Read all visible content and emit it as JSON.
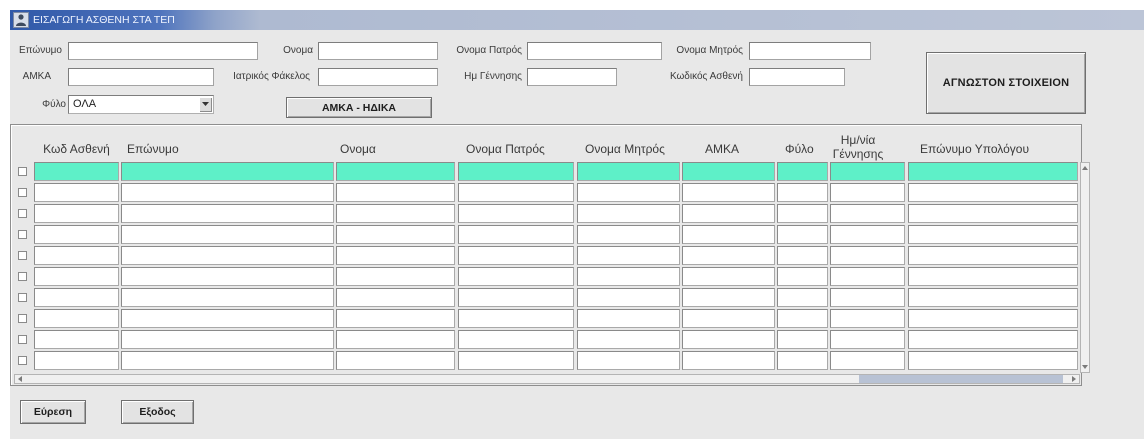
{
  "window": {
    "title": "ΕΙΣΑΓΩΓΗ ΑΣΘΕΝΗ ΣΤΑ ΤΕΠ",
    "icon": "app-icon"
  },
  "search": {
    "surname": {
      "label": "Επώνυμο",
      "value": ""
    },
    "first_name": {
      "label": "Ονομα",
      "value": ""
    },
    "father_name": {
      "label": "Ονομα Πατρός",
      "value": ""
    },
    "mother_name": {
      "label": "Ονομα Μητρός",
      "value": ""
    },
    "amka": {
      "label": "ΑΜΚΑ",
      "value": ""
    },
    "medical_file": {
      "label": "Ιατρικός Φάκελος",
      "value": ""
    },
    "birth_date": {
      "label": "Ημ Γέννησης",
      "value": ""
    },
    "patient_code": {
      "label": "Κωδικός Ασθενή",
      "value": ""
    },
    "gender": {
      "label": "Φύλο",
      "value": "ΟΛΑ",
      "icon": "chevron-down-icon"
    }
  },
  "buttons": {
    "amka_hdika": "ΑΜΚΑ - ΗΔΙΚΑ",
    "unknown_details": "ΑΓΝΩΣΤΟΝ ΣΤΟΙΧΕΙΟΝ",
    "find": "Εύρεση",
    "exit": "Εξοδος"
  },
  "table": {
    "columns": [
      {
        "key": "code",
        "label": "Κωδ Ασθενή"
      },
      {
        "key": "surname",
        "label": "Επώνυμο"
      },
      {
        "key": "first_name",
        "label": "Ονομα"
      },
      {
        "key": "father_name",
        "label": "Ονομα Πατρός"
      },
      {
        "key": "mother_name",
        "label": "Ονομα Μητρός"
      },
      {
        "key": "amka",
        "label": "ΑΜΚΑ"
      },
      {
        "key": "gender",
        "label": "Φύλο"
      },
      {
        "key": "birth_date",
        "label": "Ημ/νία Γέννησης"
      },
      {
        "key": "operator_surname",
        "label": "Επώνυμο Υπολόγου"
      }
    ],
    "selected_row": 0,
    "rows": [
      {
        "checked": false,
        "cells": [
          "",
          "",
          "",
          "",
          "",
          "",
          "",
          "",
          ""
        ]
      },
      {
        "checked": false,
        "cells": [
          "",
          "",
          "",
          "",
          "",
          "",
          "",
          "",
          ""
        ]
      },
      {
        "checked": false,
        "cells": [
          "",
          "",
          "",
          "",
          "",
          "",
          "",
          "",
          ""
        ]
      },
      {
        "checked": false,
        "cells": [
          "",
          "",
          "",
          "",
          "",
          "",
          "",
          "",
          ""
        ]
      },
      {
        "checked": false,
        "cells": [
          "",
          "",
          "",
          "",
          "",
          "",
          "",
          "",
          ""
        ]
      },
      {
        "checked": false,
        "cells": [
          "",
          "",
          "",
          "",
          "",
          "",
          "",
          "",
          ""
        ]
      },
      {
        "checked": false,
        "cells": [
          "",
          "",
          "",
          "",
          "",
          "",
          "",
          "",
          ""
        ]
      },
      {
        "checked": false,
        "cells": [
          "",
          "",
          "",
          "",
          "",
          "",
          "",
          "",
          ""
        ]
      },
      {
        "checked": false,
        "cells": [
          "",
          "",
          "",
          "",
          "",
          "",
          "",
          "",
          ""
        ]
      },
      {
        "checked": false,
        "cells": [
          "",
          "",
          "",
          "",
          "",
          "",
          "",
          "",
          ""
        ]
      }
    ]
  },
  "colors": {
    "selected_row": "#5ef0c8",
    "title_bar": "#2f58a8",
    "window_background": "#e8e8e8"
  }
}
